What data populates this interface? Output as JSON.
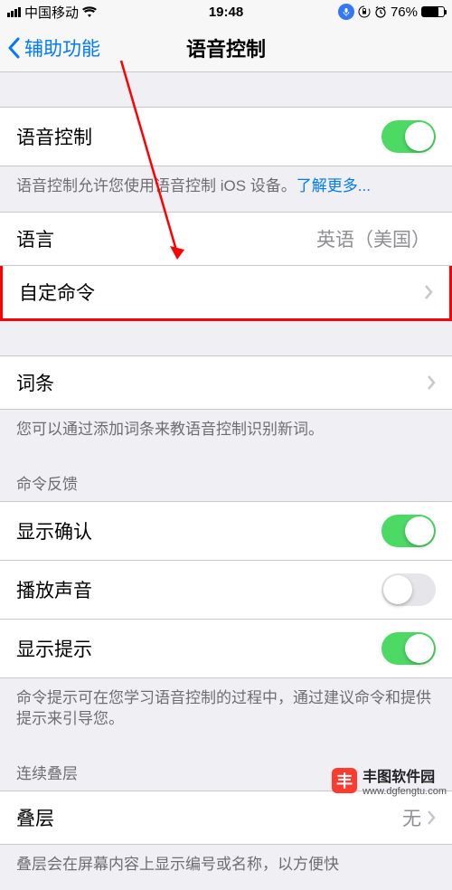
{
  "statusbar": {
    "carrier": "中国移动",
    "time": "19:48",
    "battery_pct": "76%"
  },
  "nav": {
    "back_label": "辅助功能",
    "title": "语音控制"
  },
  "section_voice": {
    "toggle_label": "语音控制",
    "toggle_on": true,
    "footer_text": "语音控制允许您使用语音控制 iOS 设备。",
    "learn_more": "了解更多..."
  },
  "section_lang": {
    "language_label": "语言",
    "language_value": "英语（美国）",
    "custom_label": "自定命令"
  },
  "section_vocab": {
    "vocab_label": "词条",
    "vocab_footer": "您可以通过添加词条来教语音控制识别新词。"
  },
  "section_feedback": {
    "header": "命令反馈",
    "confirm_label": "显示确认",
    "confirm_on": true,
    "sound_label": "播放声音",
    "sound_on": false,
    "hints_label": "显示提示",
    "hints_on": true,
    "footer": "命令提示可在您学习语音控制的过程中，通过建议命令和提供提示来引导您。"
  },
  "section_overlay": {
    "header": "连续叠层",
    "overlay_label": "叠层",
    "overlay_value": "无",
    "footer_partial": "叠层会在屏幕内容上显示编号或名称，以方便快"
  },
  "watermark": {
    "badge": "丰",
    "name": "丰图软件园",
    "url": "www.dgfengtu.com"
  }
}
